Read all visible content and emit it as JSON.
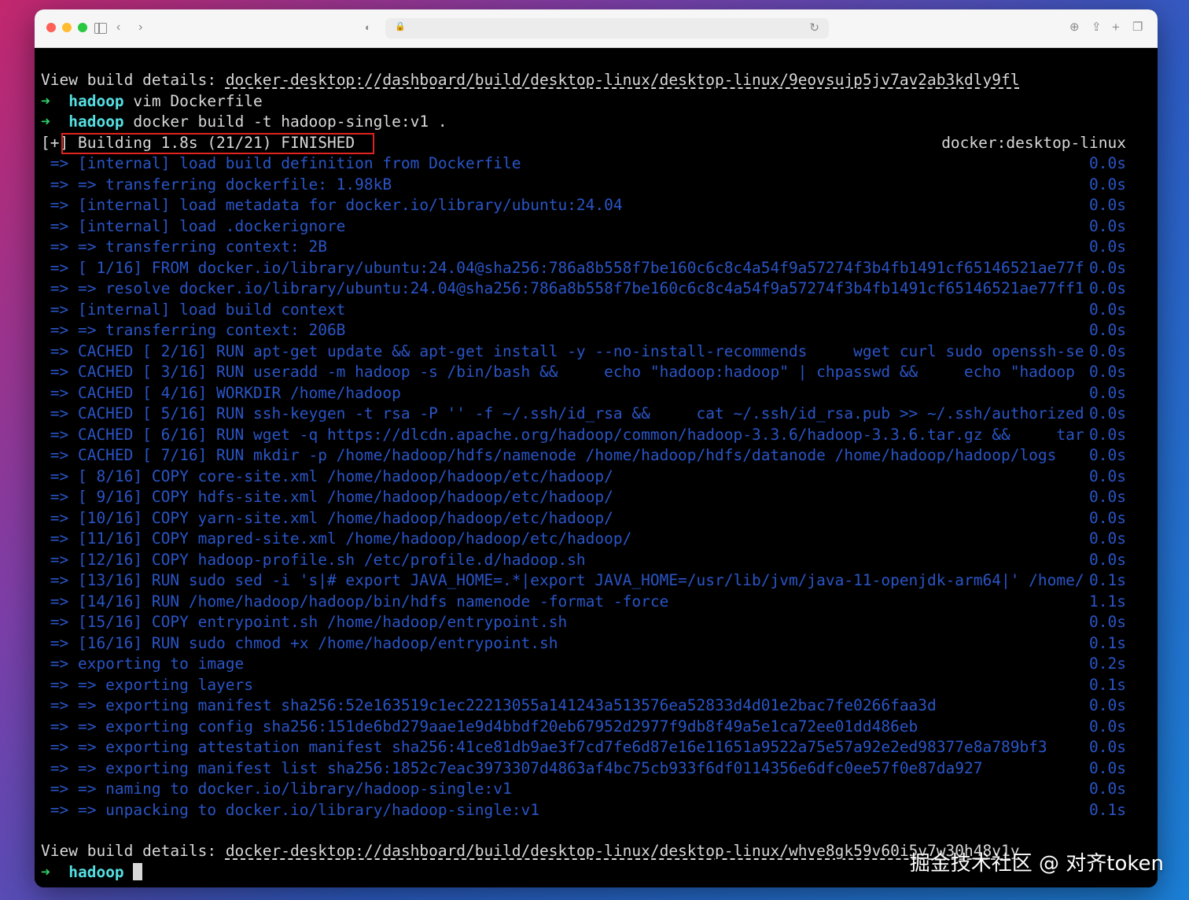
{
  "window": {
    "controls": [
      "close",
      "minimize",
      "zoom"
    ],
    "toolbar_icons": [
      "sidebar-icon",
      "back-icon",
      "forward-icon",
      "shield-icon",
      "lock-icon",
      "reload-icon",
      "translate-icon",
      "share-icon",
      "new-tab-icon",
      "tabs-icon"
    ]
  },
  "terminal": {
    "view_details_1": {
      "prefix": "View build details: ",
      "url": "docker-desktop://dashboard/build/desktop-linux/desktop-linux/9eovsujp5jv7av2ab3kdly9fl"
    },
    "prompt_1": {
      "arrow": "➜",
      "dir": "hadoop",
      "cmd": " vim Dockerfile"
    },
    "prompt_2": {
      "arrow": "➜",
      "dir": "hadoop",
      "cmd": " docker build -t hadoop-single:v1 ."
    },
    "building": {
      "text": "[+] Building 1.8s (21/21) FINISHED",
      "context": "docker:desktop-linux"
    },
    "steps": [
      {
        "text": "=> [internal] load build definition from Dockerfile",
        "time": "0.0s"
      },
      {
        "text": "=> => transferring dockerfile: 1.98kB",
        "time": "0.0s"
      },
      {
        "text": "=> [internal] load metadata for docker.io/library/ubuntu:24.04",
        "time": "0.0s"
      },
      {
        "text": "=> [internal] load .dockerignore",
        "time": "0.0s"
      },
      {
        "text": "=> => transferring context: 2B",
        "time": "0.0s"
      },
      {
        "text": "=> [ 1/16] FROM docker.io/library/ubuntu:24.04@sha256:786a8b558f7be160c6c8c4a54f9a57274f3b4fb1491cf65146521ae77f",
        "time": "0.0s"
      },
      {
        "text": "=> => resolve docker.io/library/ubuntu:24.04@sha256:786a8b558f7be160c6c8c4a54f9a57274f3b4fb1491cf65146521ae77ff1",
        "time": "0.0s"
      },
      {
        "text": "=> [internal] load build context",
        "time": "0.0s"
      },
      {
        "text": "=> => transferring context: 206B",
        "time": "0.0s"
      },
      {
        "text": "=> CACHED [ 2/16] RUN apt-get update && apt-get install -y --no-install-recommends     wget curl sudo openssh-se",
        "time": "0.0s"
      },
      {
        "text": "=> CACHED [ 3/16] RUN useradd -m hadoop -s /bin/bash &&     echo \"hadoop:hadoop\" | chpasswd &&     echo \"hadoop",
        "time": "0.0s"
      },
      {
        "text": "=> CACHED [ 4/16] WORKDIR /home/hadoop",
        "time": "0.0s"
      },
      {
        "text": "=> CACHED [ 5/16] RUN ssh-keygen -t rsa -P '' -f ~/.ssh/id_rsa &&     cat ~/.ssh/id_rsa.pub >> ~/.ssh/authorized",
        "time": "0.0s"
      },
      {
        "text": "=> CACHED [ 6/16] RUN wget -q https://dlcdn.apache.org/hadoop/common/hadoop-3.3.6/hadoop-3.3.6.tar.gz &&     tar",
        "time": "0.0s"
      },
      {
        "text": "=> CACHED [ 7/16] RUN mkdir -p /home/hadoop/hdfs/namenode /home/hadoop/hdfs/datanode /home/hadoop/hadoop/logs",
        "time": "0.0s"
      },
      {
        "text": "=> [ 8/16] COPY core-site.xml /home/hadoop/hadoop/etc/hadoop/",
        "time": "0.0s"
      },
      {
        "text": "=> [ 9/16] COPY hdfs-site.xml /home/hadoop/hadoop/etc/hadoop/",
        "time": "0.0s"
      },
      {
        "text": "=> [10/16] COPY yarn-site.xml /home/hadoop/hadoop/etc/hadoop/",
        "time": "0.0s"
      },
      {
        "text": "=> [11/16] COPY mapred-site.xml /home/hadoop/hadoop/etc/hadoop/",
        "time": "0.0s"
      },
      {
        "text": "=> [12/16] COPY hadoop-profile.sh /etc/profile.d/hadoop.sh",
        "time": "0.0s"
      },
      {
        "text": "=> [13/16] RUN sudo sed -i 's|# export JAVA_HOME=.*|export JAVA_HOME=/usr/lib/jvm/java-11-openjdk-arm64|' /home/",
        "time": "0.1s"
      },
      {
        "text": "=> [14/16] RUN /home/hadoop/hadoop/bin/hdfs namenode -format -force",
        "time": "1.1s"
      },
      {
        "text": "=> [15/16] COPY entrypoint.sh /home/hadoop/entrypoint.sh",
        "time": "0.0s"
      },
      {
        "text": "=> [16/16] RUN sudo chmod +x /home/hadoop/entrypoint.sh",
        "time": "0.1s"
      },
      {
        "text": "=> exporting to image",
        "time": "0.2s"
      },
      {
        "text": "=> => exporting layers",
        "time": "0.1s"
      },
      {
        "text": "=> => exporting manifest sha256:52e163519c1ec22213055a141243a513576ea52833d4d01e2bac7fe0266faa3d",
        "time": "0.0s"
      },
      {
        "text": "=> => exporting config sha256:151de6bd279aae1e9d4bbdf20eb67952d2977f9db8f49a5e1ca72ee01dd486eb",
        "time": "0.0s"
      },
      {
        "text": "=> => exporting attestation manifest sha256:41ce81db9ae3f7cd7fe6d87e16e11651a9522a75e57a92e2ed98377e8a789bf3",
        "time": "0.0s"
      },
      {
        "text": "=> => exporting manifest list sha256:1852c7eac3973307d4863af4bc75cb933f6df0114356e6dfc0ee57f0e87da927",
        "time": "0.0s"
      },
      {
        "text": "=> => naming to docker.io/library/hadoop-single:v1",
        "time": "0.0s"
      },
      {
        "text": "=> => unpacking to docker.io/library/hadoop-single:v1",
        "time": "0.1s"
      }
    ],
    "view_details_2": {
      "prefix": "View build details: ",
      "url": "docker-desktop://dashboard/build/desktop-linux/desktop-linux/whve8gk59v60i5v7w30h48v1y"
    },
    "prompt_3": {
      "arrow": "➜",
      "dir": "hadoop"
    }
  },
  "watermark": "掘金技术社区 @ 对齐token",
  "colors": {
    "step_blue": "#2a55c7",
    "prompt_green": "#2fd06a",
    "dir_cyan": "#55e0e3",
    "highlight_red": "#e0241f"
  }
}
